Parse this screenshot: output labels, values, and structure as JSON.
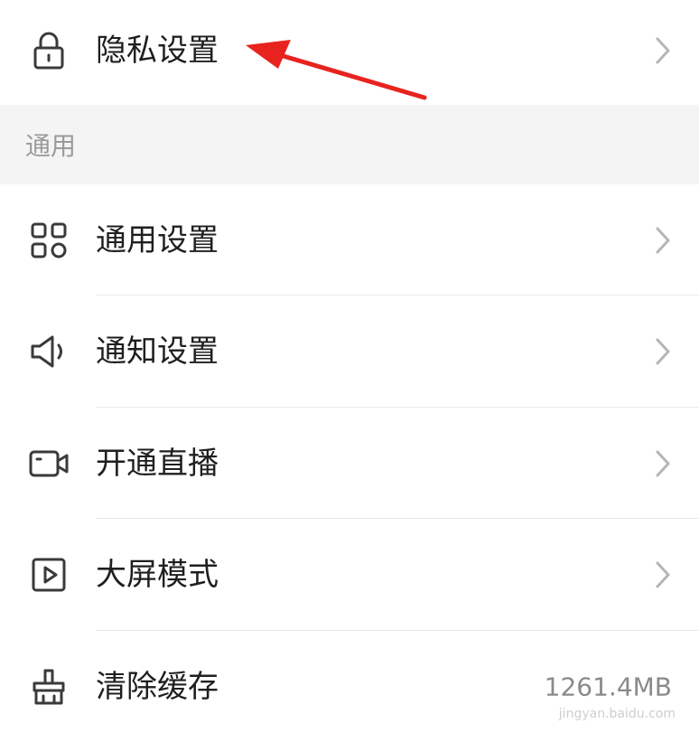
{
  "privacy_row": {
    "label": "隐私设置",
    "icon": "lock-icon"
  },
  "section": {
    "title": "通用"
  },
  "items": [
    {
      "label": "通用设置",
      "icon": "grid-icon"
    },
    {
      "label": "通知设置",
      "icon": "speaker-icon"
    },
    {
      "label": "开通直播",
      "icon": "video-camera-icon"
    },
    {
      "label": "大屏模式",
      "icon": "play-square-icon"
    },
    {
      "label": "清除缓存",
      "icon": "broom-icon",
      "value": "1261.4MB"
    }
  ],
  "colors": {
    "annotation_arrow": "#e8231f",
    "section_bg": "#f4f4f4",
    "divider": "#e8e8e8",
    "icon": "#3a3a3a",
    "chevron": "#b5b5b5"
  },
  "watermark": "jingyan.baidu.com"
}
